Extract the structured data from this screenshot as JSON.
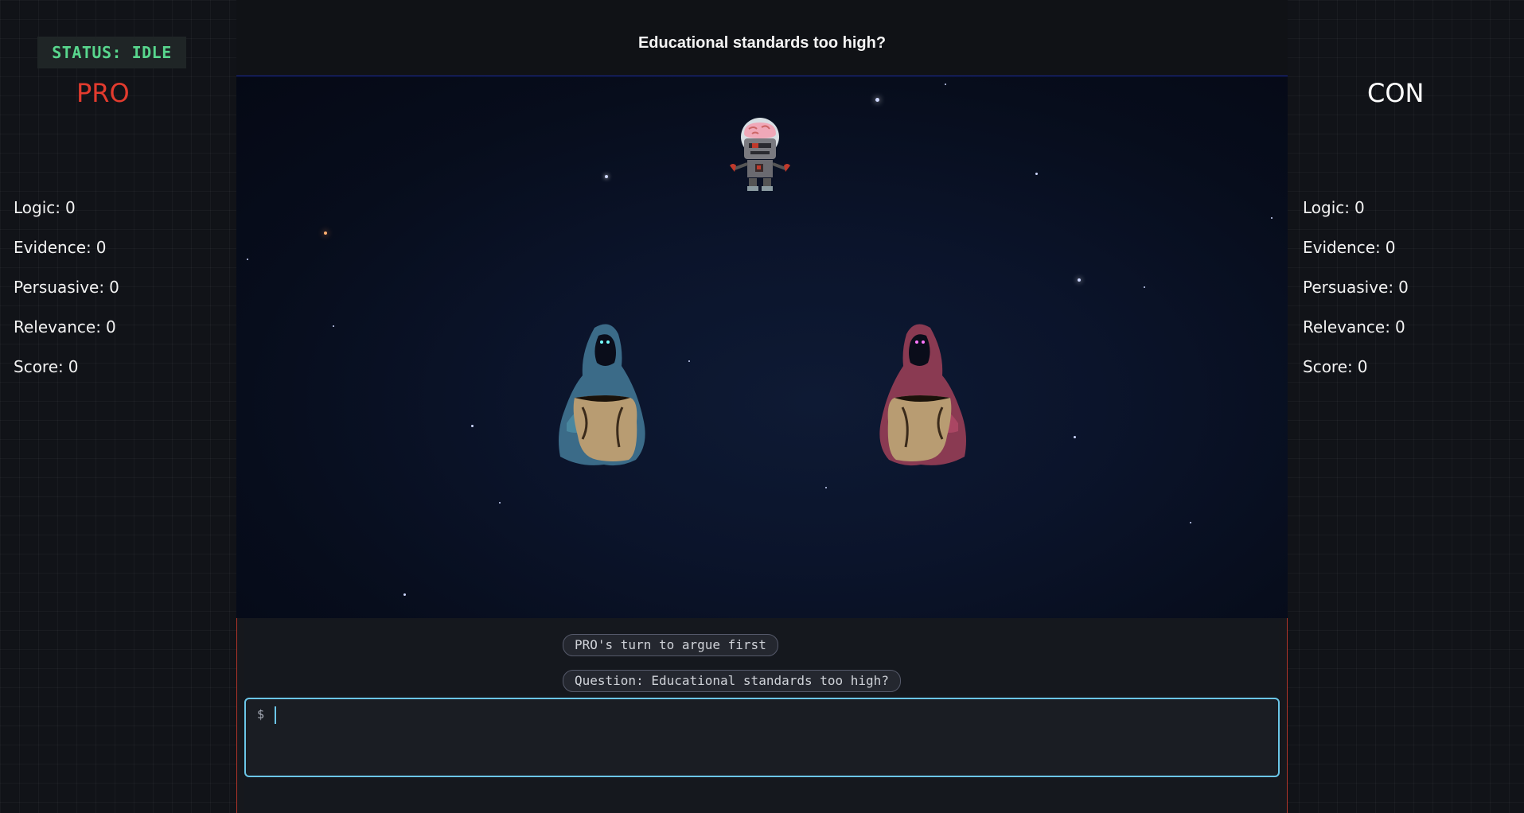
{
  "status": "STATUS: IDLE",
  "header": {
    "title": "Educational standards too high?"
  },
  "pro": {
    "title": "PRO",
    "stats": [
      {
        "label": "Logic:",
        "value": "0"
      },
      {
        "label": "Evidence:",
        "value": "0"
      },
      {
        "label": "Persuasive:",
        "value": "0"
      },
      {
        "label": "Relevance:",
        "value": "0"
      },
      {
        "label": "Score:",
        "value": "0"
      }
    ]
  },
  "con": {
    "title": "CON",
    "stats": [
      {
        "label": "Logic:",
        "value": "0"
      },
      {
        "label": "Evidence:",
        "value": "0"
      },
      {
        "label": "Persuasive:",
        "value": "0"
      },
      {
        "label": "Relevance:",
        "value": "0"
      },
      {
        "label": "Score:",
        "value": "0"
      }
    ]
  },
  "messages": [
    "PRO's turn to argue first",
    "Question: Educational standards too high?"
  ],
  "terminal": {
    "prompt": "$"
  },
  "colors": {
    "pro": "#e23b2e",
    "con": "#ffffff",
    "status": "#58d68d",
    "accent": "#6bc6e8"
  },
  "icons": [
    "robot-judge-icon",
    "pro-cloaked-figure-icon",
    "con-cloaked-figure-icon"
  ]
}
